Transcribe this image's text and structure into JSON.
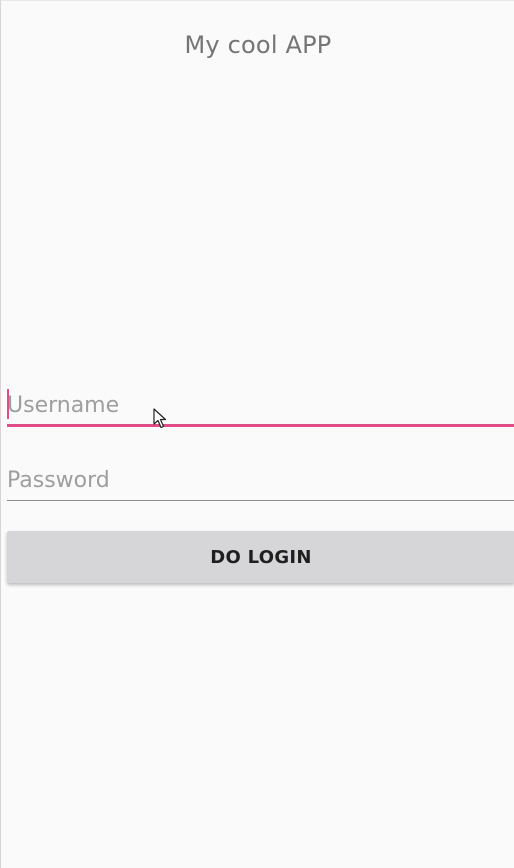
{
  "app": {
    "title": "My cool APP"
  },
  "login_form": {
    "username": {
      "placeholder": "Username",
      "value": ""
    },
    "password": {
      "placeholder": "Password",
      "value": ""
    },
    "login_button_label": "DO LOGIN"
  },
  "colors": {
    "accent": "#e24c86",
    "background": "#fafafa",
    "button": "#d6d6d8"
  },
  "icons": {
    "cursor": "mouse-pointer-icon"
  }
}
